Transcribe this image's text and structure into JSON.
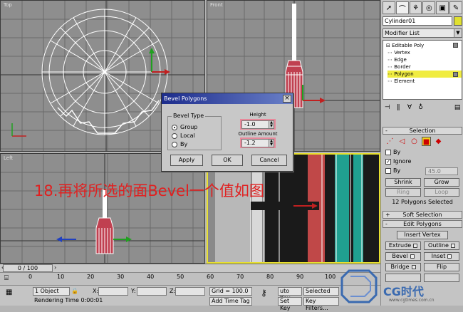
{
  "viewports": {
    "top": {
      "label": "Top"
    },
    "front": {
      "label": "Front"
    },
    "left": {
      "label": "Left"
    }
  },
  "caption": "18.再将所选的面Bevel一个值如图",
  "command_panel": {
    "object_name": "Cylinder01",
    "modifier_list": "Modifier List",
    "stack": [
      "Editable Poly",
      "Vertex",
      "Edge",
      "Border",
      "Polygon",
      "Element"
    ],
    "selected_level": "Polygon",
    "selection_header": "Selection",
    "by_vertex": "By",
    "ignore_backfacing": "Ignore",
    "by_angle": "By",
    "angle_value": "45.0",
    "shrink": "Shrink",
    "grow": "Grow",
    "ring": "Ring",
    "loop": "Loop",
    "selected_count": "12 Polygons Selected",
    "soft_selection": "Soft Selection",
    "edit_polygons": "Edit Polygons",
    "insert_vertex": "Insert Vertex",
    "extrude": "Extrude",
    "outline": "Outline",
    "bevel": "Bevel",
    "inset": "Inset",
    "bridge": "Bridge",
    "flip": "Flip"
  },
  "dialog": {
    "title": "Bevel Polygons",
    "bevel_type_label": "Bevel Type",
    "options": [
      "Group",
      "Local",
      "By"
    ],
    "selected_option": "Group",
    "height_label": "Height",
    "height_value": "-1.0",
    "outline_label": "Outline Amount",
    "outline_value": "-1.2",
    "apply": "Apply",
    "ok": "OK",
    "cancel": "Cancel"
  },
  "timeline": {
    "frame": "0 / 100",
    "ticks": [
      "0",
      "10",
      "20",
      "30",
      "40",
      "50",
      "60",
      "70",
      "80",
      "90",
      "100"
    ]
  },
  "status": {
    "selection": "1 Object",
    "x_label": "X:",
    "y_label": "Y:",
    "z_label": "Z:",
    "grid": "Grid = 100.0",
    "rendering_time": "Rendering Time  0:00:01",
    "add_time_tag": "Add Time Tag",
    "auto_key": "uto Key",
    "selected": "Selected",
    "set_key": "Set Key",
    "key_filters": "Key Filters..."
  },
  "watermark": {
    "text": "CG时代",
    "url": "www.cgtimes.com.cn"
  },
  "colors": {
    "highlight": "#f0ec40",
    "dialog_title": "#1c2c8c",
    "caption": "#e02020",
    "persp_border": "#e8e030"
  }
}
